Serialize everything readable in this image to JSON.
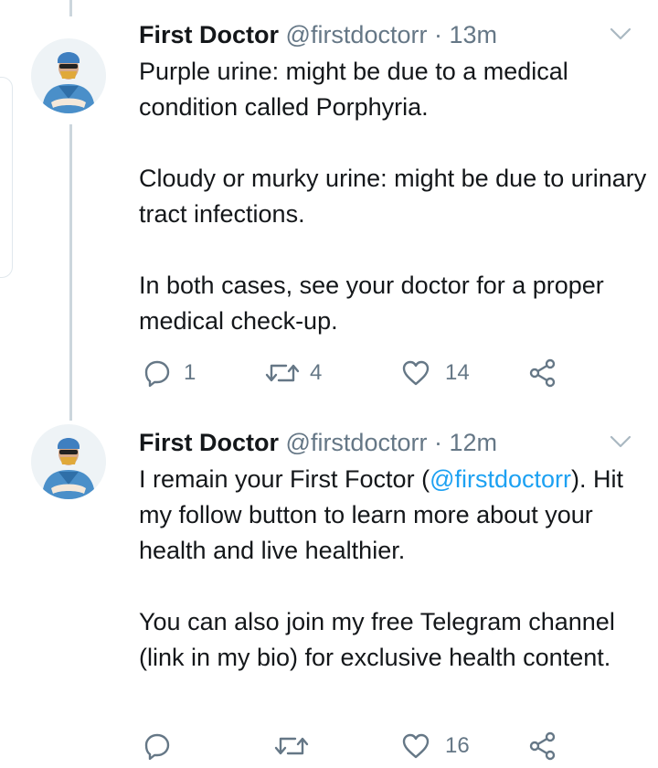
{
  "tweets": [
    {
      "name": "First Doctor",
      "handle": "@firstdoctorr",
      "separator": "·",
      "time": "13m",
      "paragraphs": [
        "Purple urine: might be due to a medical condition called Porphyria.",
        "Cloudy or murky urine: might be due to urinary tract infections.",
        "In both cases, see your doctor for a proper medical check-up."
      ],
      "reply_count": "1",
      "retweet_count": "4",
      "like_count": "14"
    },
    {
      "name": "First Doctor",
      "handle": "@firstdoctorr",
      "separator": "·",
      "time": "12m",
      "intro_before": "I remain your First Foctor (",
      "intro_mention": "@firstdoctorr",
      "intro_after": "). Hit my follow button to learn more about your health and live healthier.",
      "paragraph2": "You can also join my free Telegram channel (link in my bio) for exclusive health content.",
      "reply_count": "",
      "retweet_count": "",
      "like_count": "16"
    }
  ],
  "icons": {
    "avatar": "doctor-in-scrubs-avatar",
    "menu": "chevron-down-icon",
    "reply": "reply-icon",
    "retweet": "retweet-icon",
    "like": "heart-icon",
    "share": "share-icon"
  },
  "colors": {
    "text": "#14171a",
    "secondary": "#657786",
    "link": "#1da1f2",
    "thread_line": "#ccd6dd"
  }
}
